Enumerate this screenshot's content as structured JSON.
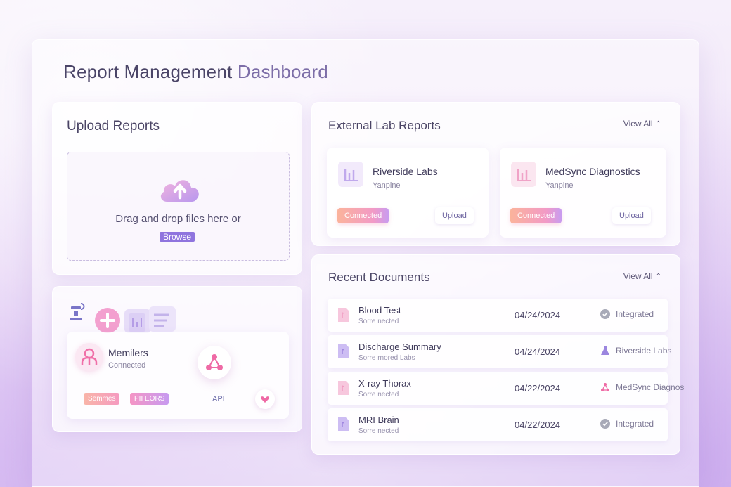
{
  "page": {
    "title_main": "Report Management",
    "title_accent": "Dashboard"
  },
  "upload": {
    "title": "Upload Reports",
    "drop_text": "Drag and drop files here or",
    "browse_label": "Browse",
    "icon": "cloud-upload-icon"
  },
  "integrations": {
    "members_label": "Memilers",
    "members_status": "Connected",
    "tags": [
      "Semmes",
      "PII EORS"
    ],
    "api_label": "API"
  },
  "labs": {
    "title": "External Lab Reports",
    "view_all": "View All",
    "items": [
      {
        "name": "Riverside Labs",
        "sub": "Yanpine",
        "status": "Connected",
        "action": "Upload"
      },
      {
        "name": "MedSync Diagnostics",
        "sub": "Yanpine",
        "status": "Connected",
        "action": "Upload"
      }
    ]
  },
  "documents": {
    "title": "Recent Documents",
    "view_all": "View All",
    "rows": [
      {
        "name": "Blood Test",
        "sub": "Sorre nected",
        "date": "04/24/2024",
        "status": "Integrated",
        "status_icon": "check-circle-icon"
      },
      {
        "name": "Discharge Summary",
        "sub": "Sorre rnored Labs",
        "date": "04/24/2024",
        "status": "Riverside Labs",
        "status_icon": "flask-icon"
      },
      {
        "name": "X-ray Thorax",
        "sub": "Sorre nected",
        "date": "04/22/2024",
        "status": "MedSync Diagnos",
        "status_icon": "network-icon"
      },
      {
        "name": "MRI Brain",
        "sub": "Sorre nected",
        "date": "04/22/2024",
        "status": "Integrated",
        "status_icon": "check-circle-icon"
      }
    ]
  },
  "colors": {
    "accent": "#8f74de",
    "badge_start": "#fbb39b",
    "badge_end": "#c89cf0",
    "check": "#a8aab8"
  }
}
